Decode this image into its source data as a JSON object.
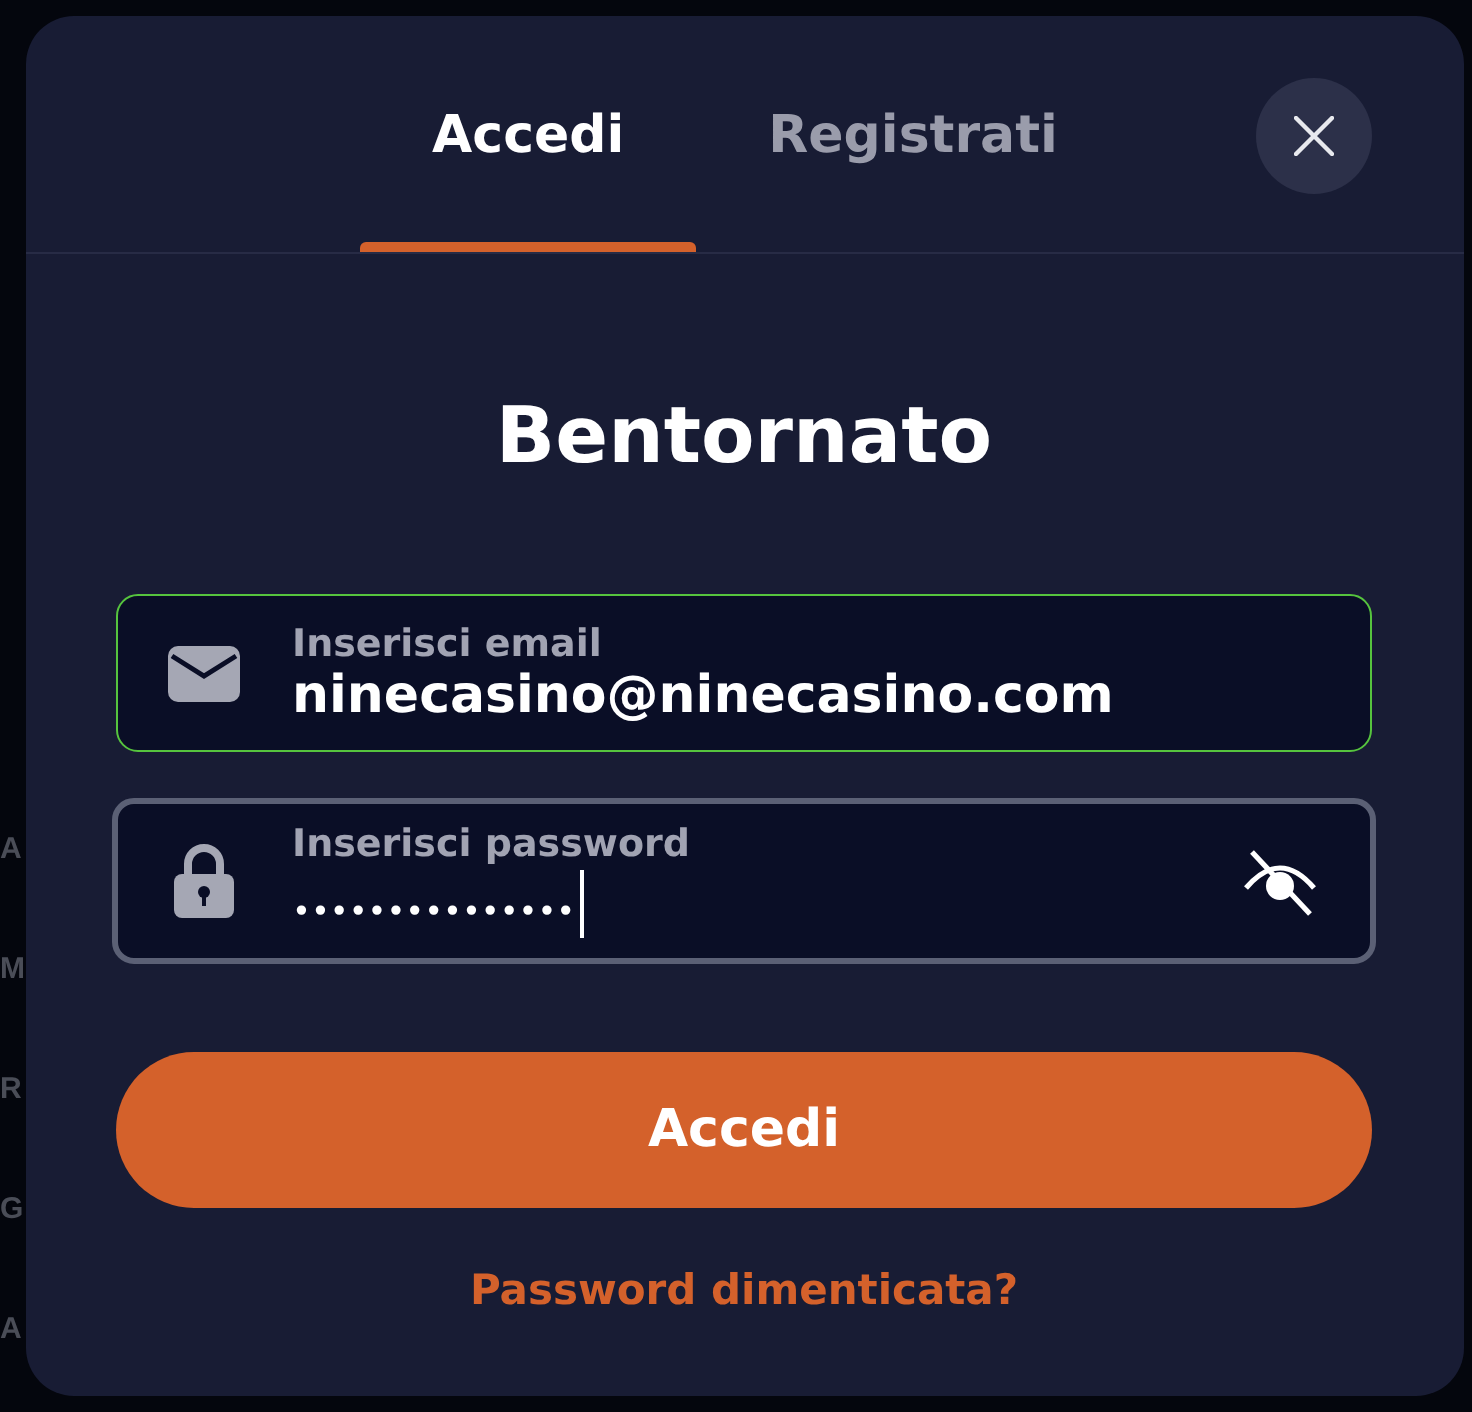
{
  "background_menu": [
    "A",
    "M",
    "R",
    "G",
    "A"
  ],
  "dialog": {
    "tabs": [
      {
        "label": "Accedi",
        "selected": true
      },
      {
        "label": "Registrati",
        "selected": false
      }
    ],
    "title": "Bentornato",
    "fields": [
      {
        "kind": "email",
        "label": "Inserisci email",
        "value": "ninecasino@ninecasino.com",
        "valid": true,
        "focused": false
      },
      {
        "kind": "password",
        "label": "Inserisci password",
        "value": "•••••••••••••••",
        "valid": false,
        "focused": true,
        "revealed": false
      }
    ],
    "submit_button": "Accedi",
    "forgot_password_link": "Password dimenticata?"
  }
}
